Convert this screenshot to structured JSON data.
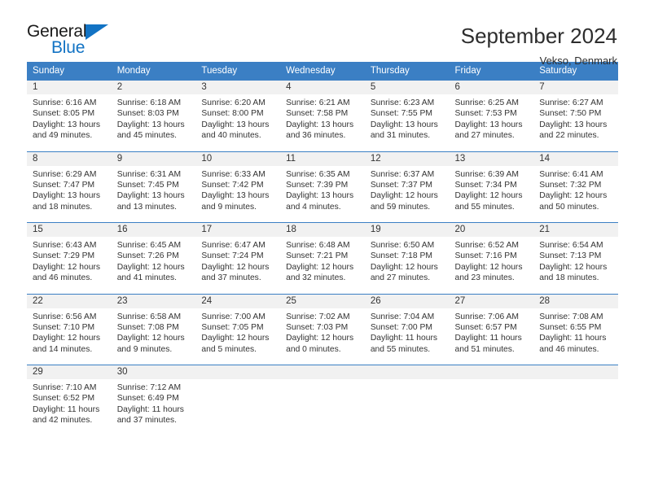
{
  "brand": {
    "name_dark": "General",
    "name_blue": "Blue",
    "accent_color": "#1273c4"
  },
  "header": {
    "title": "September 2024",
    "subtitle": "Vekso, Denmark"
  },
  "theme": {
    "header_blue": "#3b7fc4",
    "daynum_band": "#f1f1f1",
    "text": "#333333"
  },
  "calendar": {
    "weekday_headers": [
      "Sunday",
      "Monday",
      "Tuesday",
      "Wednesday",
      "Thursday",
      "Friday",
      "Saturday"
    ],
    "labels": {
      "sunrise": "Sunrise:",
      "sunset": "Sunset:",
      "daylight": "Daylight:"
    },
    "weeks": [
      [
        {
          "day": "1",
          "sunrise": "Sunrise: 6:16 AM",
          "sunset": "Sunset: 8:05 PM",
          "daylight_1": "Daylight: 13 hours",
          "daylight_2": "and 49 minutes."
        },
        {
          "day": "2",
          "sunrise": "Sunrise: 6:18 AM",
          "sunset": "Sunset: 8:03 PM",
          "daylight_1": "Daylight: 13 hours",
          "daylight_2": "and 45 minutes."
        },
        {
          "day": "3",
          "sunrise": "Sunrise: 6:20 AM",
          "sunset": "Sunset: 8:00 PM",
          "daylight_1": "Daylight: 13 hours",
          "daylight_2": "and 40 minutes."
        },
        {
          "day": "4",
          "sunrise": "Sunrise: 6:21 AM",
          "sunset": "Sunset: 7:58 PM",
          "daylight_1": "Daylight: 13 hours",
          "daylight_2": "and 36 minutes."
        },
        {
          "day": "5",
          "sunrise": "Sunrise: 6:23 AM",
          "sunset": "Sunset: 7:55 PM",
          "daylight_1": "Daylight: 13 hours",
          "daylight_2": "and 31 minutes."
        },
        {
          "day": "6",
          "sunrise": "Sunrise: 6:25 AM",
          "sunset": "Sunset: 7:53 PM",
          "daylight_1": "Daylight: 13 hours",
          "daylight_2": "and 27 minutes."
        },
        {
          "day": "7",
          "sunrise": "Sunrise: 6:27 AM",
          "sunset": "Sunset: 7:50 PM",
          "daylight_1": "Daylight: 13 hours",
          "daylight_2": "and 22 minutes."
        }
      ],
      [
        {
          "day": "8",
          "sunrise": "Sunrise: 6:29 AM",
          "sunset": "Sunset: 7:47 PM",
          "daylight_1": "Daylight: 13 hours",
          "daylight_2": "and 18 minutes."
        },
        {
          "day": "9",
          "sunrise": "Sunrise: 6:31 AM",
          "sunset": "Sunset: 7:45 PM",
          "daylight_1": "Daylight: 13 hours",
          "daylight_2": "and 13 minutes."
        },
        {
          "day": "10",
          "sunrise": "Sunrise: 6:33 AM",
          "sunset": "Sunset: 7:42 PM",
          "daylight_1": "Daylight: 13 hours",
          "daylight_2": "and 9 minutes."
        },
        {
          "day": "11",
          "sunrise": "Sunrise: 6:35 AM",
          "sunset": "Sunset: 7:39 PM",
          "daylight_1": "Daylight: 13 hours",
          "daylight_2": "and 4 minutes."
        },
        {
          "day": "12",
          "sunrise": "Sunrise: 6:37 AM",
          "sunset": "Sunset: 7:37 PM",
          "daylight_1": "Daylight: 12 hours",
          "daylight_2": "and 59 minutes."
        },
        {
          "day": "13",
          "sunrise": "Sunrise: 6:39 AM",
          "sunset": "Sunset: 7:34 PM",
          "daylight_1": "Daylight: 12 hours",
          "daylight_2": "and 55 minutes."
        },
        {
          "day": "14",
          "sunrise": "Sunrise: 6:41 AM",
          "sunset": "Sunset: 7:32 PM",
          "daylight_1": "Daylight: 12 hours",
          "daylight_2": "and 50 minutes."
        }
      ],
      [
        {
          "day": "15",
          "sunrise": "Sunrise: 6:43 AM",
          "sunset": "Sunset: 7:29 PM",
          "daylight_1": "Daylight: 12 hours",
          "daylight_2": "and 46 minutes."
        },
        {
          "day": "16",
          "sunrise": "Sunrise: 6:45 AM",
          "sunset": "Sunset: 7:26 PM",
          "daylight_1": "Daylight: 12 hours",
          "daylight_2": "and 41 minutes."
        },
        {
          "day": "17",
          "sunrise": "Sunrise: 6:47 AM",
          "sunset": "Sunset: 7:24 PM",
          "daylight_1": "Daylight: 12 hours",
          "daylight_2": "and 37 minutes."
        },
        {
          "day": "18",
          "sunrise": "Sunrise: 6:48 AM",
          "sunset": "Sunset: 7:21 PM",
          "daylight_1": "Daylight: 12 hours",
          "daylight_2": "and 32 minutes."
        },
        {
          "day": "19",
          "sunrise": "Sunrise: 6:50 AM",
          "sunset": "Sunset: 7:18 PM",
          "daylight_1": "Daylight: 12 hours",
          "daylight_2": "and 27 minutes."
        },
        {
          "day": "20",
          "sunrise": "Sunrise: 6:52 AM",
          "sunset": "Sunset: 7:16 PM",
          "daylight_1": "Daylight: 12 hours",
          "daylight_2": "and 23 minutes."
        },
        {
          "day": "21",
          "sunrise": "Sunrise: 6:54 AM",
          "sunset": "Sunset: 7:13 PM",
          "daylight_1": "Daylight: 12 hours",
          "daylight_2": "and 18 minutes."
        }
      ],
      [
        {
          "day": "22",
          "sunrise": "Sunrise: 6:56 AM",
          "sunset": "Sunset: 7:10 PM",
          "daylight_1": "Daylight: 12 hours",
          "daylight_2": "and 14 minutes."
        },
        {
          "day": "23",
          "sunrise": "Sunrise: 6:58 AM",
          "sunset": "Sunset: 7:08 PM",
          "daylight_1": "Daylight: 12 hours",
          "daylight_2": "and 9 minutes."
        },
        {
          "day": "24",
          "sunrise": "Sunrise: 7:00 AM",
          "sunset": "Sunset: 7:05 PM",
          "daylight_1": "Daylight: 12 hours",
          "daylight_2": "and 5 minutes."
        },
        {
          "day": "25",
          "sunrise": "Sunrise: 7:02 AM",
          "sunset": "Sunset: 7:03 PM",
          "daylight_1": "Daylight: 12 hours",
          "daylight_2": "and 0 minutes."
        },
        {
          "day": "26",
          "sunrise": "Sunrise: 7:04 AM",
          "sunset": "Sunset: 7:00 PM",
          "daylight_1": "Daylight: 11 hours",
          "daylight_2": "and 55 minutes."
        },
        {
          "day": "27",
          "sunrise": "Sunrise: 7:06 AM",
          "sunset": "Sunset: 6:57 PM",
          "daylight_1": "Daylight: 11 hours",
          "daylight_2": "and 51 minutes."
        },
        {
          "day": "28",
          "sunrise": "Sunrise: 7:08 AM",
          "sunset": "Sunset: 6:55 PM",
          "daylight_1": "Daylight: 11 hours",
          "daylight_2": "and 46 minutes."
        }
      ],
      [
        {
          "day": "29",
          "sunrise": "Sunrise: 7:10 AM",
          "sunset": "Sunset: 6:52 PM",
          "daylight_1": "Daylight: 11 hours",
          "daylight_2": "and 42 minutes."
        },
        {
          "day": "30",
          "sunrise": "Sunrise: 7:12 AM",
          "sunset": "Sunset: 6:49 PM",
          "daylight_1": "Daylight: 11 hours",
          "daylight_2": "and 37 minutes."
        },
        {
          "day": "",
          "sunrise": "",
          "sunset": "",
          "daylight_1": "",
          "daylight_2": ""
        },
        {
          "day": "",
          "sunrise": "",
          "sunset": "",
          "daylight_1": "",
          "daylight_2": ""
        },
        {
          "day": "",
          "sunrise": "",
          "sunset": "",
          "daylight_1": "",
          "daylight_2": ""
        },
        {
          "day": "",
          "sunrise": "",
          "sunset": "",
          "daylight_1": "",
          "daylight_2": ""
        },
        {
          "day": "",
          "sunrise": "",
          "sunset": "",
          "daylight_1": "",
          "daylight_2": ""
        }
      ]
    ]
  }
}
